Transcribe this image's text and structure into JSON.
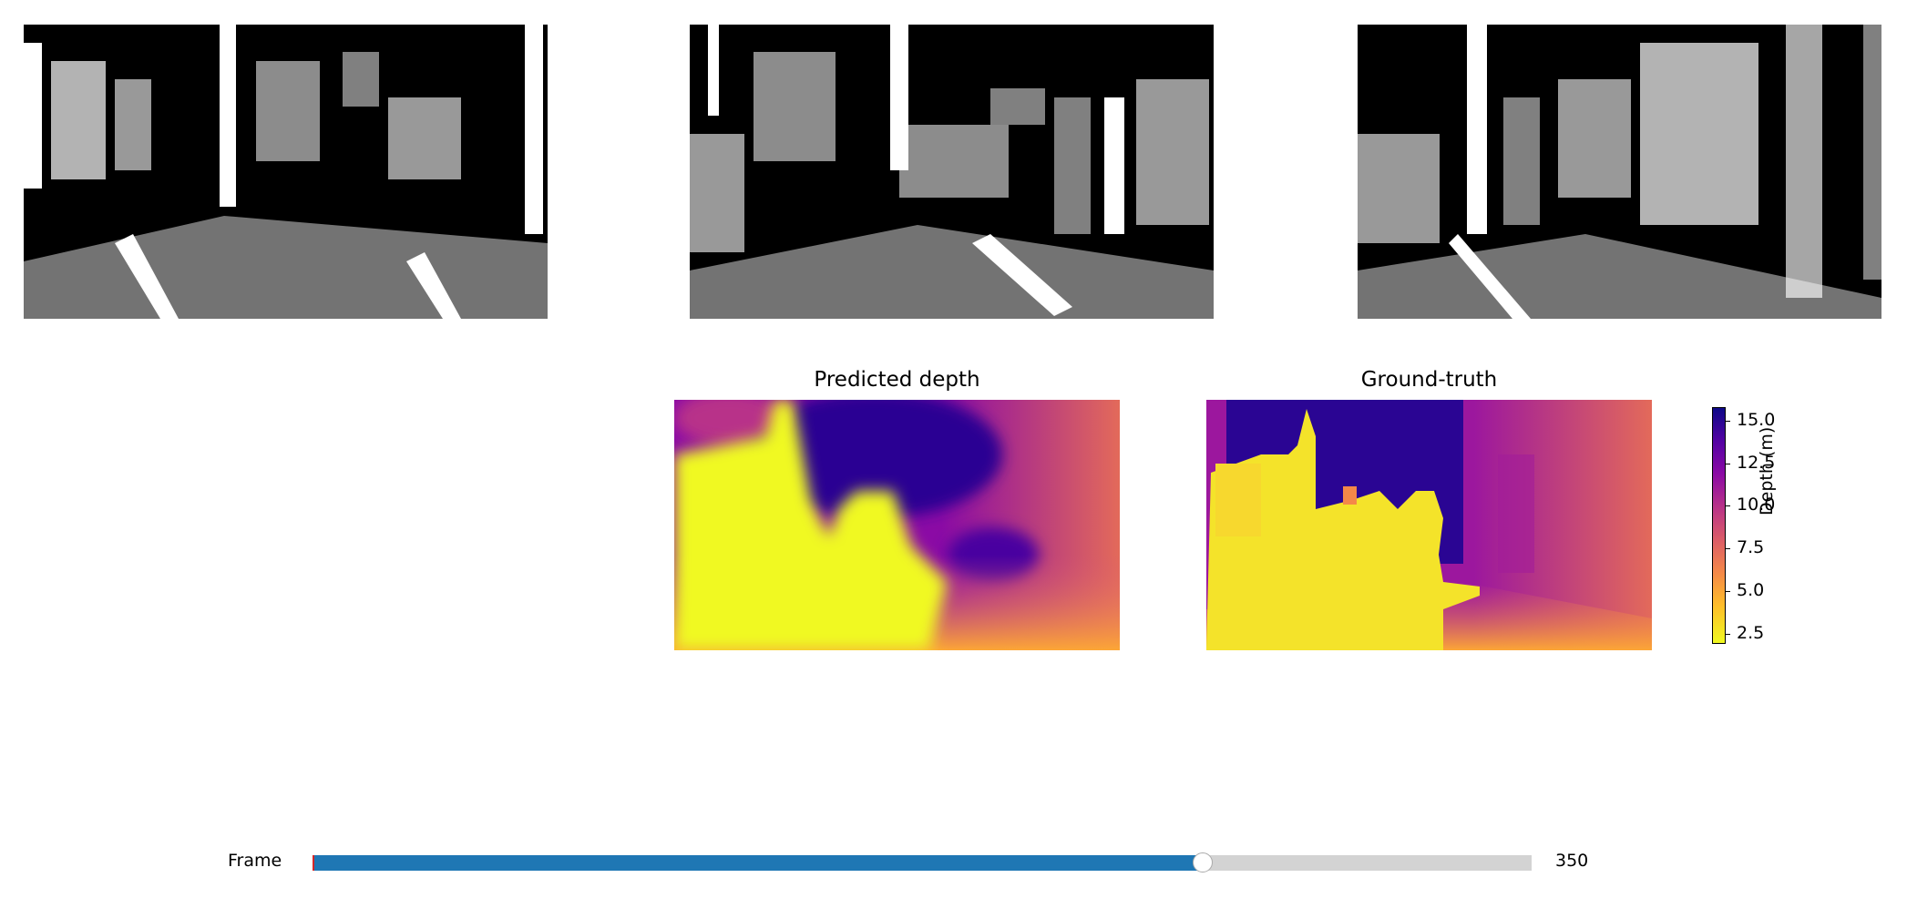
{
  "views": [
    {
      "name": "left-camera-view"
    },
    {
      "name": "center-camera-view"
    },
    {
      "name": "right-camera-view"
    }
  ],
  "predicted": {
    "title": "Predicted depth"
  },
  "ground_truth": {
    "title": "Ground-truth"
  },
  "colorbar": {
    "label": "Depth (m)",
    "colormap": "plasma_r",
    "range": [
      2.0,
      15.8
    ],
    "ticks": [
      "15.0",
      "12.5",
      "10.0",
      "7.5",
      "5.0",
      "2.5"
    ],
    "tick_values": [
      15.0,
      12.5,
      10.0,
      7.5,
      5.0,
      2.5
    ]
  },
  "slider": {
    "label": "Frame",
    "value": "350",
    "fraction": 0.73
  },
  "colors": {
    "slider_fill": "#1f77b4",
    "slider_track": "#d3d3d3",
    "near": "#f0f921",
    "far": "#0d0887"
  }
}
